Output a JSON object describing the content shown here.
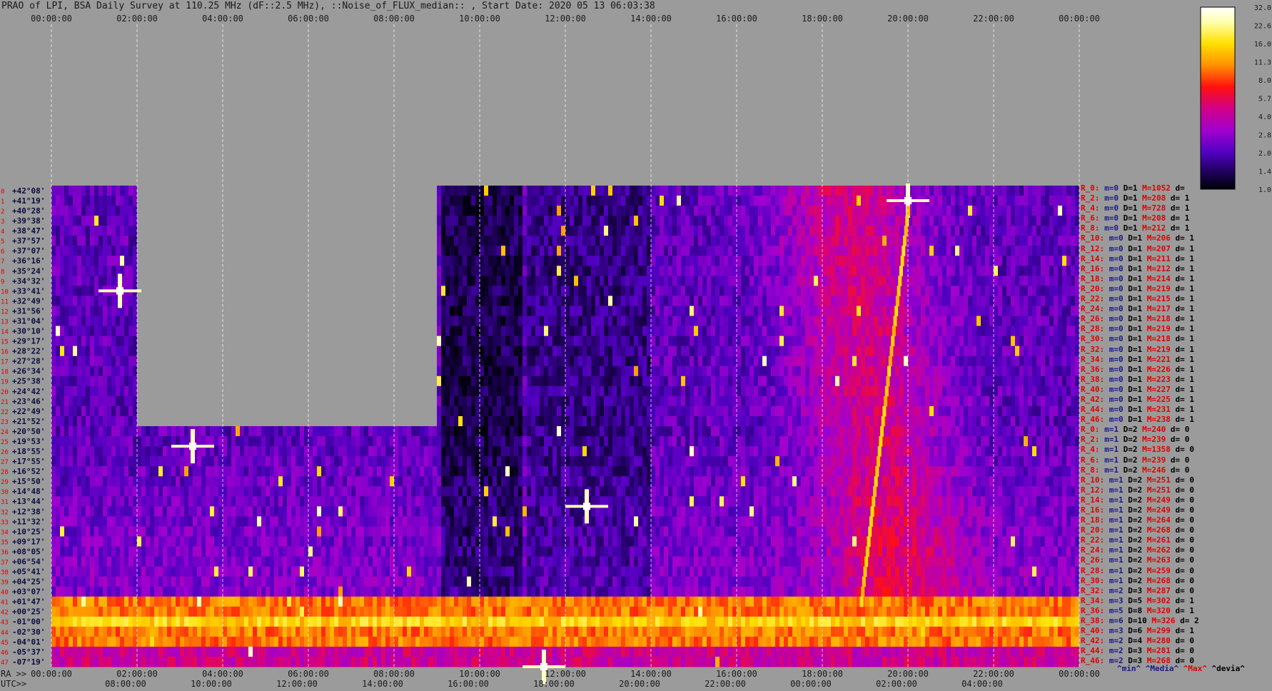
{
  "window": {
    "title": "PRAO of LPI, BSA Daily Survey at 110.25 MHz (dF::2.5 MHz), ::Noise_of_FLUX_median:: , Start Date: 2020 05 13 06:03:38"
  },
  "axes": {
    "ra_prefix": "RA >>",
    "utc_prefix": "UTC>>"
  },
  "chart_data": {
    "type": "heatmap",
    "title": "PRAO of LPI, BSA Daily Survey at 110.25 MHz (dF::2.5 MHz), ::Noise_of_FLUX_median:: , Start Date: 2020 05 13 06:03:38",
    "x_top_ticks": [
      "00:00:00",
      "02:00:00",
      "04:00:00",
      "06:00:00",
      "08:00:00",
      "10:00:00",
      "12:00:00",
      "14:00:00",
      "16:00:00",
      "18:00:00",
      "20:00:00",
      "22:00:00",
      "00:00:00"
    ],
    "x_bottom_ra_ticks": [
      "00:00:00",
      "02:00:00",
      "04:00:00",
      "06:00:00",
      "08:00:00",
      "10:00:00",
      "12:00:00",
      "14:00:00",
      "16:00:00",
      "18:00:00",
      "20:00:00",
      "22:00:00",
      "00:00:00"
    ],
    "x_bottom_utc_ticks": [
      "08:00:00",
      "10:00:00",
      "12:00:00",
      "14:00:00",
      "16:00:00",
      "18:00:00",
      "20:00:00",
      "22:00:00",
      "00:00:00",
      "02:00:00",
      "04:00:00"
    ],
    "x_range_hours": [
      0,
      24
    ],
    "y_labels": [
      "+42°08'",
      "+41°19'",
      "+40°28'",
      "+39°38'",
      "+38°47'",
      "+37°57'",
      "+37°07'",
      "+36°16'",
      "+35°24'",
      "+34°32'",
      "+33°41'",
      "+32°49'",
      "+31°56'",
      "+31°04'",
      "+30°10'",
      "+29°17'",
      "+28°22'",
      "+27°28'",
      "+26°34'",
      "+25°38'",
      "+24°42'",
      "+23°46'",
      "+22°49'",
      "+21°52'",
      "+20°50'",
      "+19°53'",
      "+18°55'",
      "+17°55'",
      "+16°52'",
      "+15°50'",
      "+14°48'",
      "+13°44'",
      "+12°38'",
      "+11°32'",
      "+10°25'",
      "+09°17'",
      "+08°05'",
      "+06°54'",
      "+05°41'",
      "+04°25'",
      "+03°07'",
      "+01°47'",
      "+00°25'",
      "-01°00'",
      "-02°30'",
      "-04°01'",
      "-05°37'",
      "-07°19'"
    ],
    "colorbar": {
      "ticks": [
        "32.0",
        "22.6",
        "16.0",
        "11.3",
        "8.0",
        "5.7",
        "4.0",
        "2.8",
        "2.0",
        "1.4",
        "1.0"
      ],
      "scale": "log",
      "range": [
        1.0,
        32.0
      ]
    },
    "masked_regions": [
      {
        "x_start_hours": 2.0,
        "x_end_hours": 9.0,
        "dec_top": "+42°08'",
        "dec_bottom": "+21°52'"
      }
    ],
    "coverage_start_hours": 0,
    "coverage_gap": {
      "x_start_hours": 2.0,
      "x_end_hours": 9.0
    }
  },
  "right_panel": {
    "rows": [
      {
        "r": "R_0:",
        "m": "m=0",
        "d": "D=1",
        "max": "M=1052",
        "dv": "d="
      },
      {
        "r": "R_2:",
        "m": "m=0",
        "d": "D=1",
        "max": "M=208",
        "dv": "d= 1"
      },
      {
        "r": "R_4:",
        "m": "m=0",
        "d": "D=1",
        "max": "M=728",
        "dv": "d= 1"
      },
      {
        "r": "R_6:",
        "m": "m=0",
        "d": "D=1",
        "max": "M=208",
        "dv": "d= 1"
      },
      {
        "r": "R_8:",
        "m": "m=0",
        "d": "D=1",
        "max": "M=212",
        "dv": "d= 1"
      },
      {
        "r": "R_10:",
        "m": "m=0",
        "d": "D=1",
        "max": "M=206",
        "dv": "d= 1"
      },
      {
        "r": "R_12:",
        "m": "m=0",
        "d": "D=1",
        "max": "M=207",
        "dv": "d= 1"
      },
      {
        "r": "R_14:",
        "m": "m=0",
        "d": "D=1",
        "max": "M=211",
        "dv": "d= 1"
      },
      {
        "r": "R_16:",
        "m": "m=0",
        "d": "D=1",
        "max": "M=212",
        "dv": "d= 1"
      },
      {
        "r": "R_18:",
        "m": "m=0",
        "d": "D=1",
        "max": "M=214",
        "dv": "d= 1"
      },
      {
        "r": "R_20:",
        "m": "m=0",
        "d": "D=1",
        "max": "M=219",
        "dv": "d= 1"
      },
      {
        "r": "R_22:",
        "m": "m=0",
        "d": "D=1",
        "max": "M=215",
        "dv": "d= 1"
      },
      {
        "r": "R_24:",
        "m": "m=0",
        "d": "D=1",
        "max": "M=217",
        "dv": "d= 1"
      },
      {
        "r": "R_26:",
        "m": "m=0",
        "d": "D=1",
        "max": "M=218",
        "dv": "d= 1"
      },
      {
        "r": "R_28:",
        "m": "m=0",
        "d": "D=1",
        "max": "M=219",
        "dv": "d= 1"
      },
      {
        "r": "R_30:",
        "m": "m=0",
        "d": "D=1",
        "max": "M=218",
        "dv": "d= 1"
      },
      {
        "r": "R_32:",
        "m": "m=0",
        "d": "D=1",
        "max": "M=219",
        "dv": "d= 1"
      },
      {
        "r": "R_34:",
        "m": "m=0",
        "d": "D=1",
        "max": "M=221",
        "dv": "d= 1"
      },
      {
        "r": "R_36:",
        "m": "m=0",
        "d": "D=1",
        "max": "M=226",
        "dv": "d= 1"
      },
      {
        "r": "R_38:",
        "m": "m=0",
        "d": "D=1",
        "max": "M=223",
        "dv": "d= 1"
      },
      {
        "r": "R_40:",
        "m": "m=0",
        "d": "D=1",
        "max": "M=227",
        "dv": "d= 1"
      },
      {
        "r": "R_42:",
        "m": "m=0",
        "d": "D=1",
        "max": "M=225",
        "dv": "d= 1"
      },
      {
        "r": "R_44:",
        "m": "m=0",
        "d": "D=1",
        "max": "M=231",
        "dv": "d= 1"
      },
      {
        "r": "R_46:",
        "m": "m=0",
        "d": "D=1",
        "max": "M=238",
        "dv": "d= 1"
      },
      {
        "r": "R_0:",
        "m": "m=1",
        "d": "D=2",
        "max": "M=240",
        "dv": "d= 0"
      },
      {
        "r": "R_2:",
        "m": "m=1",
        "d": "D=2",
        "max": "M=239",
        "dv": "d= 0"
      },
      {
        "r": "R_4:",
        "m": "m=1",
        "d": "D=2",
        "max": "M=1358",
        "dv": "d= 0"
      },
      {
        "r": "R_6:",
        "m": "m=1",
        "d": "D=2",
        "max": "M=239",
        "dv": "d= 0"
      },
      {
        "r": "R_8:",
        "m": "m=1",
        "d": "D=2",
        "max": "M=246",
        "dv": "d= 0"
      },
      {
        "r": "R_10:",
        "m": "m=1",
        "d": "D=2",
        "max": "M=251",
        "dv": "d= 0"
      },
      {
        "r": "R_12:",
        "m": "m=1",
        "d": "D=2",
        "max": "M=251",
        "dv": "d= 0"
      },
      {
        "r": "R_14:",
        "m": "m=1",
        "d": "D=2",
        "max": "M=249",
        "dv": "d= 0"
      },
      {
        "r": "R_16:",
        "m": "m=1",
        "d": "D=2",
        "max": "M=249",
        "dv": "d= 0"
      },
      {
        "r": "R_18:",
        "m": "m=1",
        "d": "D=2",
        "max": "M=264",
        "dv": "d= 0"
      },
      {
        "r": "R_20:",
        "m": "m=1",
        "d": "D=2",
        "max": "M=268",
        "dv": "d= 0"
      },
      {
        "r": "R_22:",
        "m": "m=1",
        "d": "D=2",
        "max": "M=261",
        "dv": "d= 0"
      },
      {
        "r": "R_24:",
        "m": "m=1",
        "d": "D=2",
        "max": "M=262",
        "dv": "d= 0"
      },
      {
        "r": "R_26:",
        "m": "m=1",
        "d": "D=2",
        "max": "M=263",
        "dv": "d= 0"
      },
      {
        "r": "R_28:",
        "m": "m=1",
        "d": "D=2",
        "max": "M=259",
        "dv": "d= 0"
      },
      {
        "r": "R_30:",
        "m": "m=1",
        "d": "D=2",
        "max": "M=268",
        "dv": "d= 0"
      },
      {
        "r": "R_32:",
        "m": "m=2",
        "d": "D=3",
        "max": "M=287",
        "dv": "d= 0"
      },
      {
        "r": "R_34:",
        "m": "m=3",
        "d": "D=5",
        "max": "M=302",
        "dv": "d= 1"
      },
      {
        "r": "R_36:",
        "m": "m=5",
        "d": "D=8",
        "max": "M=320",
        "dv": "d= 1"
      },
      {
        "r": "R_38:",
        "m": "m=6",
        "d": "D=10",
        "max": "M=326",
        "dv": "d= 2"
      },
      {
        "r": "R_40:",
        "m": "m=3",
        "d": "D=6",
        "max": "M=299",
        "dv": "d= 1"
      },
      {
        "r": "R_42:",
        "m": "m=2",
        "d": "D=4",
        "max": "M=280",
        "dv": "d= 0"
      },
      {
        "r": "R_44:",
        "m": "m=2",
        "d": "D=3",
        "max": "M=281",
        "dv": "d= 0"
      },
      {
        "r": "R_46:",
        "m": "m=2",
        "d": "D=3",
        "max": "M=268",
        "dv": "d= 0"
      }
    ],
    "legend": {
      "min": "^min^",
      "median": "^Media^",
      "max": "^Max^",
      "devia": "^devia^"
    }
  },
  "colors": {
    "background": "#9b9b9b",
    "gridline": "#ffffff",
    "row_index": "#e00000",
    "dec_label": "#0a0a40",
    "min_label": "#1a1a8a",
    "max_label": "#e00000"
  }
}
